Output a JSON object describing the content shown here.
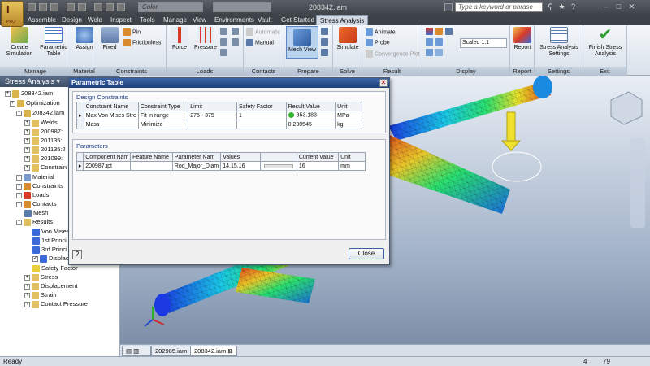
{
  "app": {
    "badge": "I",
    "badge_sub": "PRO"
  },
  "titlebar": {
    "color_combo": "Color",
    "window_title": "208342.iam",
    "search_placeholder": "Type a keyword or phrase"
  },
  "tabs": [
    "Assemble",
    "Design",
    "Weld",
    "Inspect",
    "Tools",
    "Manage",
    "View",
    "Environments",
    "Vault",
    "Get Started",
    "Stress Analysis"
  ],
  "ribbon": {
    "panels": [
      "Manage",
      "Material",
      "Constraints",
      "Loads",
      "Contacts",
      "Prepare",
      "Solve",
      "Result",
      "Display",
      "Report",
      "Settings",
      "Exit"
    ],
    "create_simulation": "Create Simulation",
    "parametric_table": "Parametric Table",
    "assign": "Assign",
    "fixed": "Fixed",
    "pin": "Pin",
    "frictionless": "Frictionless",
    "force": "Force",
    "pressure": "Pressure",
    "automatic": "Automatic",
    "manual": "Manual",
    "mesh_view": "Mesh View",
    "simulate": "Simulate",
    "animate": "Animate",
    "probe": "Probe",
    "convergence_plot": "Convergence Plot",
    "scale": "Scaled 1:1",
    "report": "Report",
    "stress_settings": "Stress Analysis Settings",
    "finish": "Finish Stress Analysis"
  },
  "browser": {
    "header": "Stress Analysis",
    "nodes": [
      "208342.iam",
      "Optimization",
      "208342.iam",
      "Welds",
      "200987:",
      "201135:",
      "201135:2",
      "201099:",
      "Constrain",
      "Material",
      "Constraints",
      "Loads",
      "Contacts",
      "Mesh",
      "Results",
      "Von Mises",
      "1st Princi",
      "3rd Princi",
      "Displac",
      "Safety Factor",
      "Stress",
      "Displacement",
      "Strain",
      "Contact Pressure"
    ]
  },
  "dialog": {
    "title": "Parametric Table",
    "design_constraints_label": "Design Constraints",
    "dc_headers": [
      "Constraint Name",
      "Constraint Type",
      "Limit",
      "Safety Factor",
      "Result Value",
      "Unit"
    ],
    "dc_rows": [
      [
        "Max Von Mises Stre",
        "Fit in range",
        "275 - 375",
        "1",
        "353.183",
        "MPa"
      ],
      [
        "Mass",
        "Minimize",
        "",
        "",
        "0.230545",
        "kg"
      ]
    ],
    "parameters_label": "Parameters",
    "p_headers": [
      "Component Nam",
      "Feature Name",
      "Parameter Nam",
      "Values",
      "",
      "Current Value",
      "Unit"
    ],
    "p_rows": [
      [
        "200987.ipt",
        "",
        "Rod_Major_Diam",
        "14,15,16",
        "",
        "16",
        "mm"
      ]
    ],
    "help": "?",
    "close": "Close"
  },
  "doc_tabs": [
    "202985.iam",
    "208342.iam"
  ],
  "status": {
    "text": "Ready",
    "n1": "4",
    "n2": "79"
  },
  "colors": {
    "accent": "#1f3f7a",
    "ribbon": "#dfe6ee",
    "active_tab": "#cfd8e3"
  }
}
